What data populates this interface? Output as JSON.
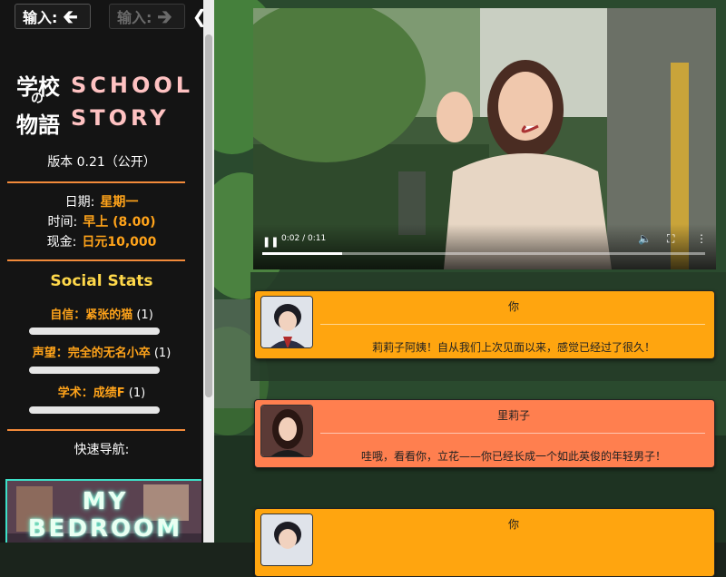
{
  "sidebar": {
    "input_back": {
      "label": "输入:",
      "icon": "arrow-left-icon"
    },
    "input_forward": {
      "label": "输入:",
      "icon": "arrow-right-icon"
    },
    "collapse_icon": "chevron-left-icon",
    "logo": {
      "cjk_top": "学校",
      "cjk_small": "の",
      "cjk_bottom": "物語",
      "en_top": "SCHOOL",
      "en_bottom": "STORY"
    },
    "version": "版本 0.21（公开）",
    "info": {
      "date_label": "日期:",
      "date_value": "星期一",
      "time_label": "时间:",
      "time_value": "早上 (8.00)",
      "money_label": "现金:",
      "money_value": "日元10,000"
    },
    "social_stats": {
      "title": "Social Stats",
      "items": [
        {
          "name": "自信：紧张的猫",
          "count": "(1)",
          "level": 0.0
        },
        {
          "name": "声望：完全的无名小卒",
          "count": "(1)",
          "level": 0.0
        },
        {
          "name": "学术：成绩F",
          "count": "(1)",
          "level": 0.0
        }
      ]
    },
    "quick_nav_label": "快速导航:",
    "bedroom_card": {
      "line1": "MY",
      "line2": "BEDROOM"
    }
  },
  "video": {
    "time": "0:02 / 0:11",
    "progress": 0.18,
    "play_icon": "pause-icon",
    "volume_icon": "volume-icon",
    "fullscreen_icon": "fullscreen-icon",
    "more_icon": "more-vertical-icon"
  },
  "dialogues": [
    {
      "speaker": "你",
      "text": "莉莉子阿姨！自从我们上次见面以来，感觉已经过了很久！",
      "color": "#ffa50f"
    },
    {
      "speaker": "里莉子",
      "text": "哇哦，看看你，立花——你已经长成一个如此英俊的年轻男子！",
      "color": "#ff7f4f"
    },
    {
      "speaker": "你",
      "text": "",
      "color": "#ffa50f"
    }
  ],
  "colors": {
    "accent_orange": "#ffa31a",
    "rule_orange": "#f28a3a",
    "social_title_yellow": "#ffd84a",
    "logo_pink": "#ffc2c2",
    "bedroom_glow": "#5fffd9"
  }
}
